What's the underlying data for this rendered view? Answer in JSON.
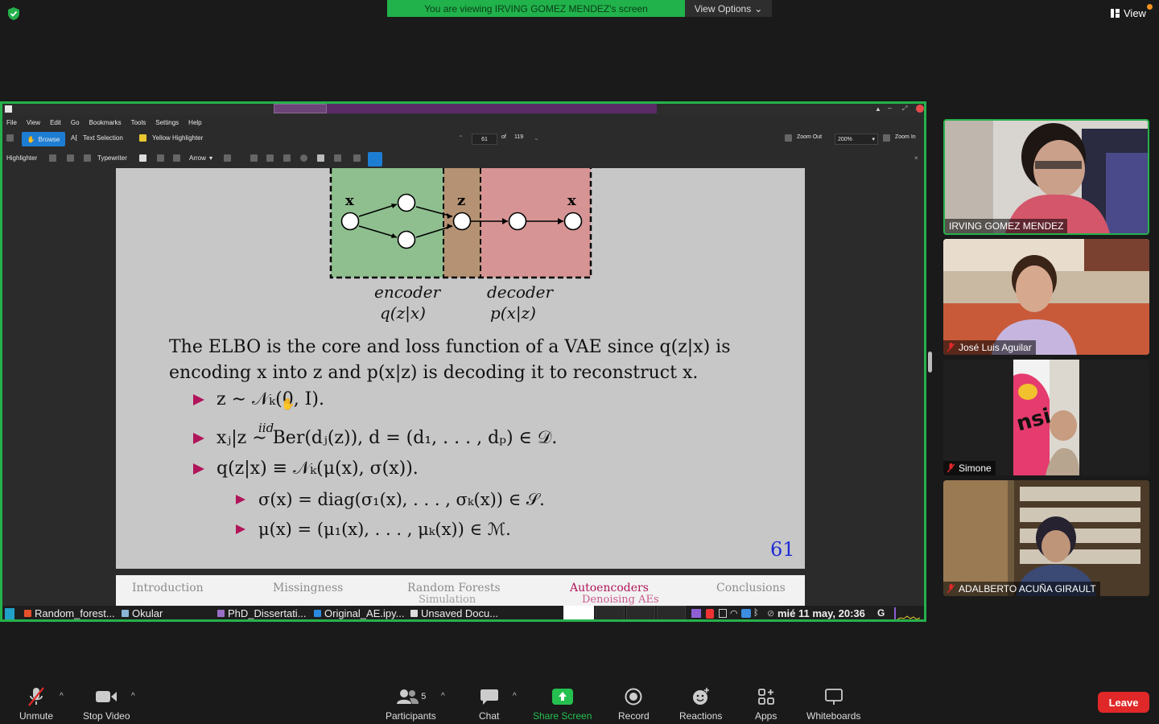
{
  "top_bar": {
    "share_banner": "You are viewing IRVING GOMEZ MENDEZ's screen",
    "view_options": "View Options",
    "view": "View"
  },
  "okular": {
    "menu": [
      "File",
      "View",
      "Edit",
      "Go",
      "Bookmarks",
      "Tools",
      "Settings",
      "Help"
    ],
    "toolbar": {
      "browse": "Browse",
      "text_selection": "Text Selection",
      "yellow_highlighter": "Yellow Highlighter",
      "page_current": "61",
      "page_of": "of",
      "page_total": "119",
      "zoom_out": "Zoom Out",
      "zoom_value": "200%",
      "zoom_in": "Zoom In"
    },
    "annot_toolbar": {
      "highlighter": "Highlighter",
      "typewriter": "Typewriter",
      "arrow": "Arrow"
    }
  },
  "slide": {
    "diagram": {
      "x_in": "x",
      "z": "z",
      "x_out": "x",
      "encoder": "encoder",
      "encoder_formula": "q(z|x)",
      "decoder": "decoder",
      "decoder_formula": "p(x|z)",
      "colors": {
        "encoder": "#8fbf8f",
        "latent": "#b49273",
        "decoder": "#d79494"
      }
    },
    "para_line1": "The ELBO is the core and loss function of a VAE since q(z|x) is",
    "para_line2": "encoding x into z and p(x|z) is decoding it to reconstruct x.",
    "bullets": [
      "z ∼ 𝒩ₖ(0, I).",
      "xⱼ|z ∼ Ber(dⱼ(z)), d = (d₁, . . . , dₚ) ∈ 𝒟.",
      "q(z|x) ≡ 𝒩ₖ(μ(x), σ(x))."
    ],
    "bullet2_iid": "iid",
    "sub_bullets": [
      "σ(x) = diag(σ₁(x), . . . , σₖ(x)) ∈ 𝒮.",
      "μ(x) = (μ₁(x), . . . , μₖ(x)) ∈ ℳ."
    ],
    "page_number": "61",
    "accent": "#b0155a"
  },
  "slide_nav": {
    "items": [
      "Introduction",
      "Missingness",
      "Random Forests",
      "Autoencoders",
      "Conclusions"
    ],
    "sub_random_forests": "Simulation",
    "sub_autoencoders": "Denoising AEs"
  },
  "taskbar": {
    "items": [
      "Random_forest...",
      "Okular",
      "PhD_Dissertati...",
      "Original_AE.ipy...",
      "Unsaved Docu..."
    ],
    "clock": "mié 11 may, 20:36"
  },
  "participants": [
    {
      "name": "IRVING GOMEZ MENDEZ",
      "muted": false
    },
    {
      "name": "José Luis Aguilar",
      "muted": true
    },
    {
      "name": "Simone",
      "muted": true
    },
    {
      "name": "ADALBERTO ACUÑA GIRAULT",
      "muted": true
    }
  ],
  "bottom_bar": {
    "unmute": "Unmute",
    "stop_video": "Stop Video",
    "participants": "Participants",
    "participants_count": "5",
    "chat": "Chat",
    "share_screen": "Share Screen",
    "record": "Record",
    "reactions": "Reactions",
    "apps": "Apps",
    "whiteboards": "Whiteboards",
    "leave": "Leave"
  }
}
